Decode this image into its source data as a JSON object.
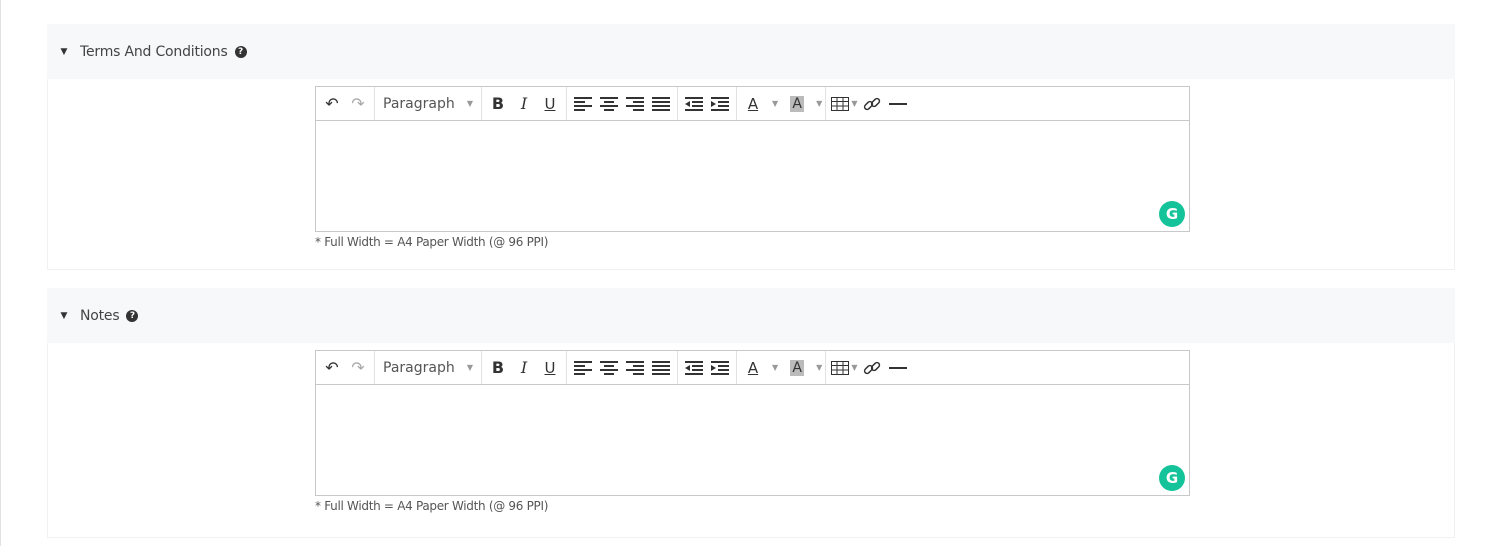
{
  "sections": [
    {
      "title": "Terms And Conditions",
      "help_icon": "question-circle-icon",
      "editor": {
        "format_select": "Paragraph",
        "content": "",
        "hint": "* Full Width = A4 Paper Width (@ 96 PPI)"
      }
    },
    {
      "title": "Notes",
      "help_icon": "question-circle-icon",
      "editor": {
        "format_select": "Paragraph",
        "content": "",
        "hint": "* Full Width = A4 Paper Width (@ 96 PPI)"
      }
    }
  ],
  "toolbar": {
    "undo": "↶",
    "redo": "↷",
    "bold": "B",
    "italic": "I",
    "underline": "U",
    "text_color": "A",
    "bg_color": "A",
    "grammarly": "G"
  },
  "colors": {
    "header_bg": "#f7f8f9",
    "grammarly": "#15c39a",
    "border": "#c8c8c8"
  }
}
